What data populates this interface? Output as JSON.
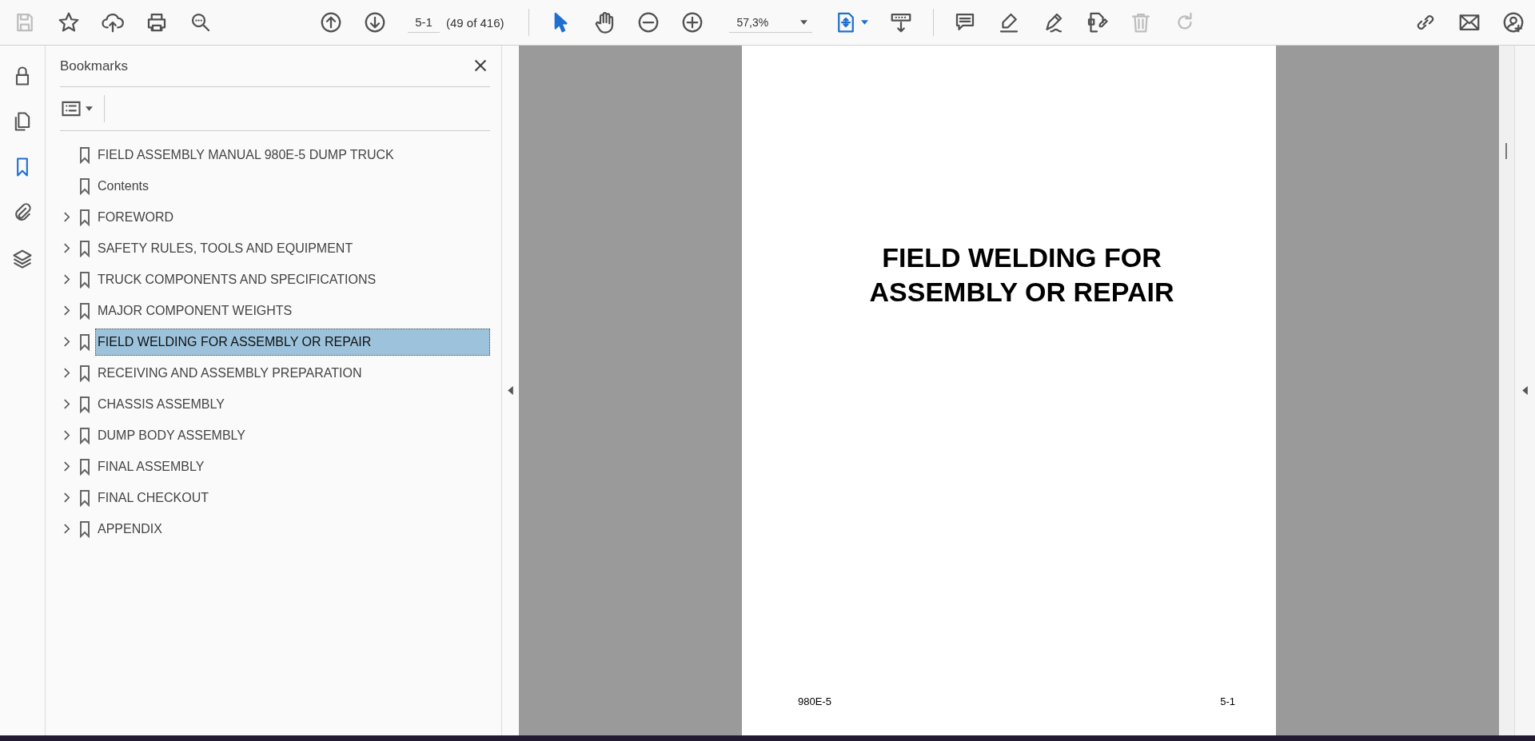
{
  "toolbar": {
    "left_tools": [
      {
        "kind": "save",
        "disabled": true
      },
      {
        "kind": "star",
        "disabled": false
      },
      {
        "kind": "upload",
        "disabled": false
      },
      {
        "kind": "print",
        "disabled": false
      },
      {
        "kind": "find",
        "disabled": false
      }
    ],
    "nav_tools": [
      {
        "kind": "up",
        "disabled": false
      },
      {
        "kind": "down",
        "disabled": false
      }
    ],
    "page_field": {
      "value": "5-1"
    },
    "page_count": "(49 of 416)",
    "view_tools": [
      {
        "kind": "pointer",
        "selected": true
      },
      {
        "kind": "hand",
        "selected": false
      },
      {
        "kind": "zoom-out",
        "selected": false
      },
      {
        "kind": "zoom-in",
        "selected": false
      }
    ],
    "zoom_field": {
      "value": "57,3%"
    },
    "edit_tools": [
      {
        "kind": "comment",
        "disabled": false
      },
      {
        "kind": "highlight",
        "disabled": false
      },
      {
        "kind": "sign",
        "disabled": false
      },
      {
        "kind": "export",
        "disabled": false
      },
      {
        "kind": "delete",
        "disabled": true
      },
      {
        "kind": "redo",
        "disabled": true
      }
    ],
    "right_tools": [
      {
        "kind": "link",
        "disabled": false
      },
      {
        "kind": "mail",
        "disabled": false
      },
      {
        "kind": "user",
        "disabled": false
      }
    ]
  },
  "rail": [
    {
      "kind": "lock",
      "selected": false
    },
    {
      "kind": "pages",
      "selected": false
    },
    {
      "kind": "bookmark",
      "selected": true
    },
    {
      "kind": "clip",
      "selected": false
    },
    {
      "kind": "layers",
      "selected": false
    }
  ],
  "bookmarks": {
    "title": "Bookmarks",
    "items": [
      {
        "label": "FIELD ASSEMBLY MANUAL 980E-5  DUMP TRUCK",
        "expandable": false,
        "selected": false
      },
      {
        "label": "Contents",
        "expandable": false,
        "selected": false
      },
      {
        "label": "FOREWORD",
        "expandable": true,
        "selected": false
      },
      {
        "label": "SAFETY RULES, TOOLS AND EQUIPMENT",
        "expandable": true,
        "selected": false
      },
      {
        "label": "TRUCK COMPONENTS AND SPECIFICATIONS",
        "expandable": true,
        "selected": false
      },
      {
        "label": "MAJOR COMPONENT WEIGHTS",
        "expandable": true,
        "selected": false
      },
      {
        "label": "FIELD WELDING FOR ASSEMBLY OR REPAIR",
        "expandable": true,
        "selected": true
      },
      {
        "label": "RECEIVING AND ASSEMBLY PREPARATION",
        "expandable": true,
        "selected": false
      },
      {
        "label": "CHASSIS ASSEMBLY",
        "expandable": true,
        "selected": false
      },
      {
        "label": "DUMP BODY ASSEMBLY",
        "expandable": true,
        "selected": false
      },
      {
        "label": "FINAL ASSEMBLY",
        "expandable": true,
        "selected": false
      },
      {
        "label": "FINAL CHECKOUT",
        "expandable": true,
        "selected": false
      },
      {
        "label": "APPENDIX",
        "expandable": true,
        "selected": false
      }
    ]
  },
  "page": {
    "title": "FIELD WELDING FOR ASSEMBLY OR REPAIR",
    "footer_left": "980E-5",
    "footer_right": "5-1"
  }
}
